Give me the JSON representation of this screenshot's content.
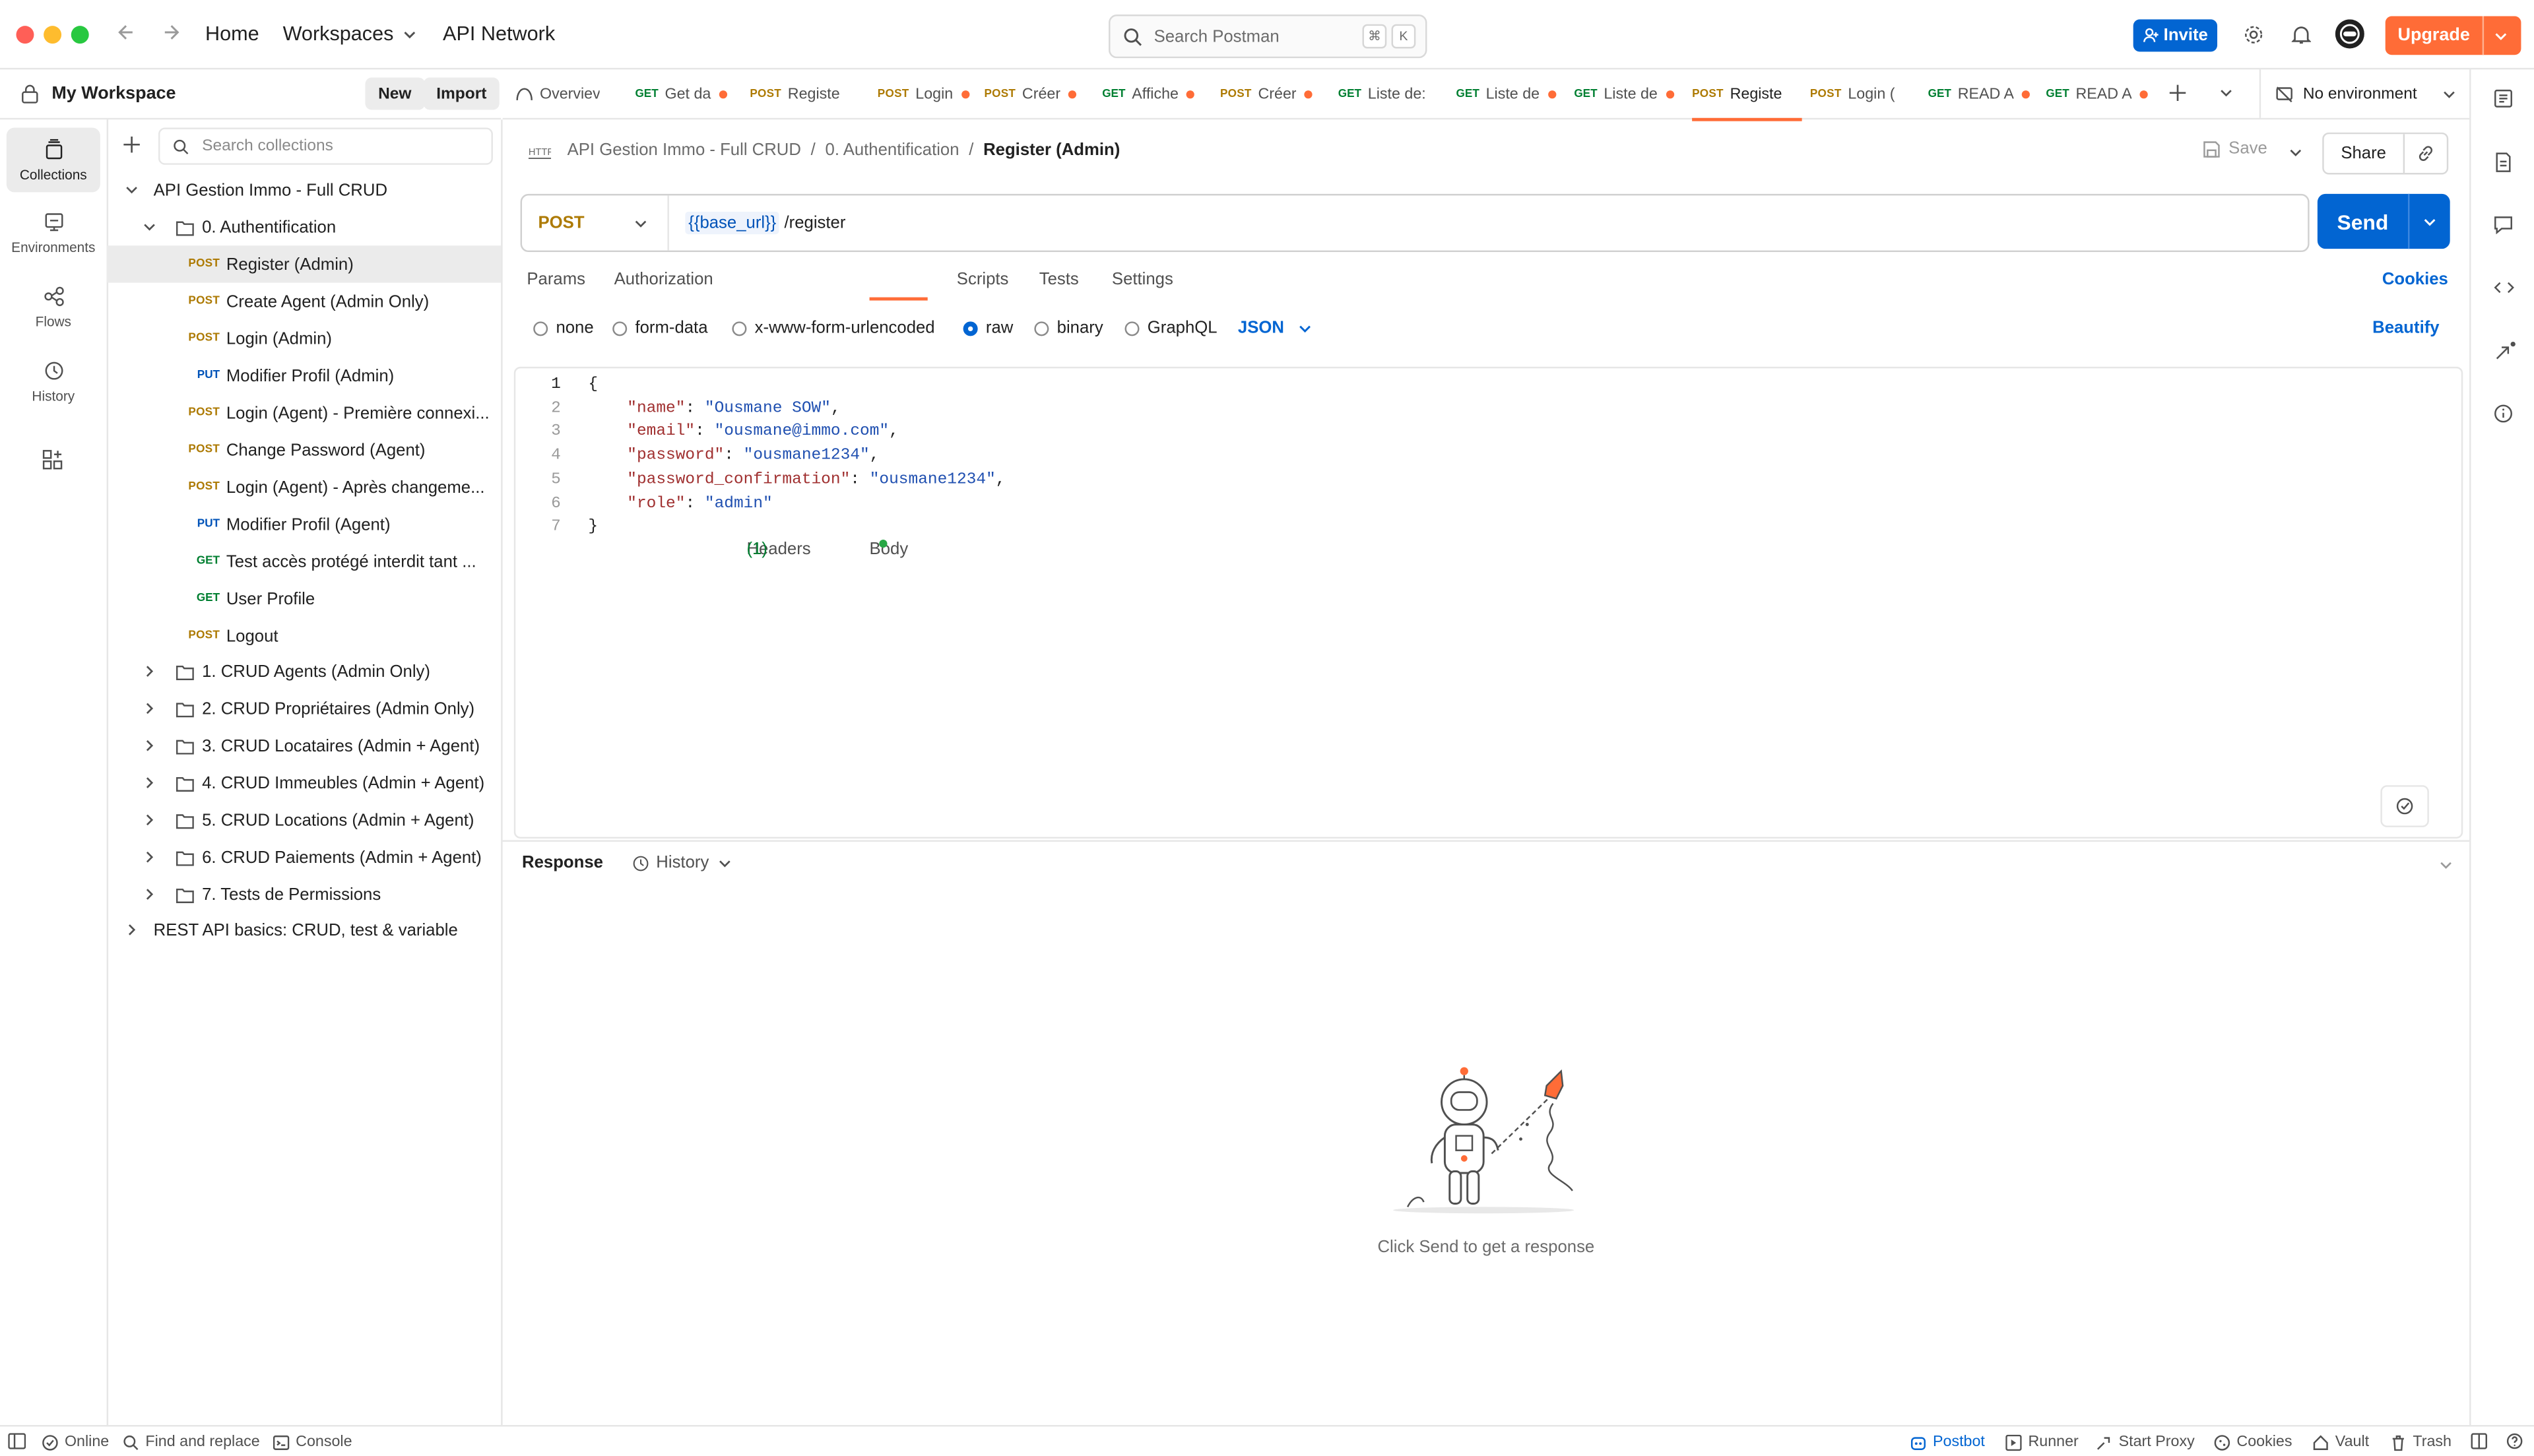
{
  "topbar": {
    "home": "Home",
    "workspaces": "Workspaces",
    "api_network": "API Network",
    "search_placeholder": "Search Postman",
    "shortcut_cmd": "⌘",
    "shortcut_key": "K",
    "invite": "Invite",
    "upgrade": "Upgrade"
  },
  "workspace": {
    "name": "My Workspace",
    "new": "New",
    "import": "Import"
  },
  "rail": [
    {
      "label": "Collections",
      "icon": "collections-icon"
    },
    {
      "label": "Environments",
      "icon": "environments-icon"
    },
    {
      "label": "Flows",
      "icon": "flows-icon"
    },
    {
      "label": "History",
      "icon": "history-icon"
    }
  ],
  "sidebar": {
    "search_placeholder": "Search collections",
    "collection": "API Gestion Immo - Full CRUD",
    "folder_open": "0. Authentification",
    "requests": [
      {
        "method": "POST",
        "name": "Register (Admin)"
      },
      {
        "method": "POST",
        "name": "Create Agent (Admin Only)"
      },
      {
        "method": "POST",
        "name": "Login (Admin)"
      },
      {
        "method": "PUT",
        "name": "Modifier Profil (Admin)"
      },
      {
        "method": "POST",
        "name": "Login (Agent) - Première connexi..."
      },
      {
        "method": "POST",
        "name": "Change Password (Agent)"
      },
      {
        "method": "POST",
        "name": "Login (Agent) - Après changeme..."
      },
      {
        "method": "PUT",
        "name": "Modifier Profil (Agent)"
      },
      {
        "method": "GET",
        "name": "Test accès protégé interdit tant ..."
      },
      {
        "method": "GET",
        "name": "User Profile"
      },
      {
        "method": "POST",
        "name": "Logout"
      }
    ],
    "folders": [
      "1. CRUD Agents (Admin Only)",
      "2. CRUD Propriétaires (Admin Only)",
      "3. CRUD Locataires (Admin + Agent)",
      "4. CRUD Immeubles (Admin + Agent)",
      "5. CRUD Locations (Admin + Agent)",
      "6. CRUD Paiements (Admin + Agent)",
      "7. Tests de Permissions"
    ],
    "other_collection": "REST API basics: CRUD, test & variable"
  },
  "tabs": [
    {
      "method": "",
      "label": "Overviev",
      "dot": false
    },
    {
      "method": "GET",
      "label": "Get da",
      "dot": true
    },
    {
      "method": "POST",
      "label": "Registe",
      "dot": false
    },
    {
      "method": "POST",
      "label": "Login",
      "dot": true
    },
    {
      "method": "POST",
      "label": "Créer",
      "dot": true
    },
    {
      "method": "GET",
      "label": "Affiche",
      "dot": true
    },
    {
      "method": "POST",
      "label": "Créer",
      "dot": true
    },
    {
      "method": "GET",
      "label": "Liste de:",
      "dot": false
    },
    {
      "method": "GET",
      "label": "Liste de",
      "dot": true
    },
    {
      "method": "GET",
      "label": "Liste de",
      "dot": true
    },
    {
      "method": "POST",
      "label": "Registe",
      "dot": false,
      "active": true
    },
    {
      "method": "POST",
      "label": "Login (",
      "dot": false
    },
    {
      "method": "GET",
      "label": "READ A",
      "dot": true
    },
    {
      "method": "GET",
      "label": "READ A",
      "dot": true
    }
  ],
  "environment": "No environment",
  "breadcrumb": {
    "collection": "API Gestion Immo - Full CRUD",
    "folder": "0. Authentification",
    "current": "Register (Admin)",
    "sep": "/"
  },
  "actions": {
    "save": "Save",
    "share": "Share"
  },
  "request": {
    "method": "POST",
    "url_var": "{{base_url}}",
    "url_path": "/register",
    "send": "Send"
  },
  "subtabs": {
    "params": "Params",
    "authorization": "Authorization",
    "headers": "Headers",
    "headers_count": "(1)",
    "body": "Body",
    "scripts": "Scripts",
    "tests": "Tests",
    "settings": "Settings",
    "cookies": "Cookies"
  },
  "body_options": {
    "none": "none",
    "form_data": "form-data",
    "urlencoded": "x-www-form-urlencoded",
    "raw": "raw",
    "binary": "binary",
    "graphql": "GraphQL",
    "format": "JSON",
    "beautify": "Beautify"
  },
  "code": [
    {
      "n": "1",
      "text": "{"
    },
    {
      "n": "2",
      "key": "\"name\"",
      "val": "\"Ousmane SOW\"",
      "end": ","
    },
    {
      "n": "3",
      "key": "\"email\"",
      "val": "\"ousmane@immo.com\"",
      "end": ","
    },
    {
      "n": "4",
      "key": "\"password\"",
      "val": "\"ousmane1234\"",
      "end": ","
    },
    {
      "n": "5",
      "key": "\"password_confirmation\"",
      "val": "\"ousmane1234\"",
      "end": ","
    },
    {
      "n": "6",
      "key": "\"role\"",
      "val": "\"admin\"",
      "end": ""
    },
    {
      "n": "7",
      "text": "}"
    }
  ],
  "response": {
    "title": "Response",
    "history": "History",
    "empty": "Click Send to get a response"
  },
  "footer": {
    "online": "Online",
    "find": "Find and replace",
    "console": "Console",
    "postbot": "Postbot",
    "runner": "Runner",
    "proxy": "Start Proxy",
    "cookies": "Cookies",
    "vault": "Vault",
    "trash": "Trash"
  },
  "colors": {
    "accent": "#ff6c37",
    "primary": "#0265d2",
    "post": "#ad7a03",
    "get": "#007f31",
    "put": "#0053b8"
  }
}
